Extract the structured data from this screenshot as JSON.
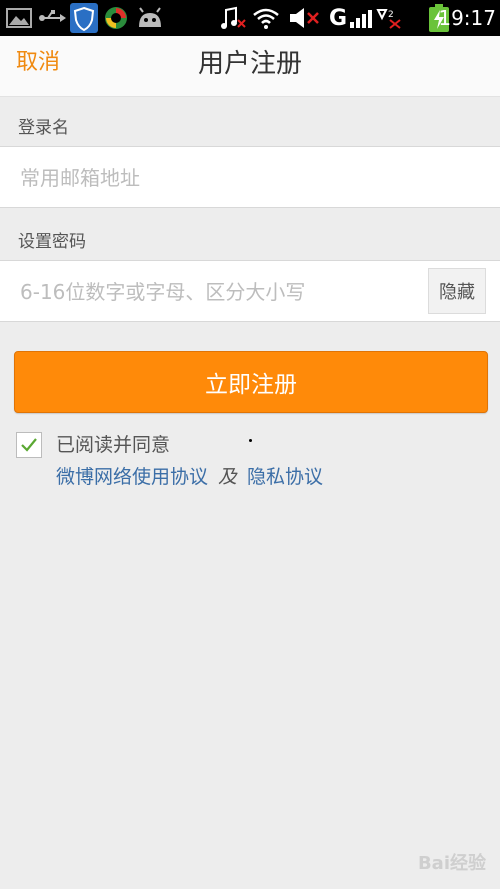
{
  "status_bar": {
    "time": "19:17",
    "network_letter": "G",
    "icons": [
      "image-icon",
      "usb-icon",
      "shield-icon",
      "sync-icon",
      "android-icon",
      "music-off-icon",
      "wifi-icon",
      "mute-icon",
      "signal-icon",
      "battery-charging-icon"
    ]
  },
  "header": {
    "cancel": "取消",
    "title": "用户注册"
  },
  "form": {
    "login_label": "登录名",
    "email_placeholder": "常用邮箱地址",
    "password_label": "设置密码",
    "password_placeholder": "6-16位数字或字母、区分大小写",
    "hide_button": "隐藏"
  },
  "register_button": "立即注册",
  "agreement": {
    "text": "已阅读并同意",
    "link1": "微博网络使用协议",
    "separator": "及",
    "link2": "隐私协议"
  },
  "watermark": "Bai经验",
  "colors": {
    "accent": "#ff8a09",
    "link": "#3b6ea7",
    "check": "#5aa832"
  }
}
